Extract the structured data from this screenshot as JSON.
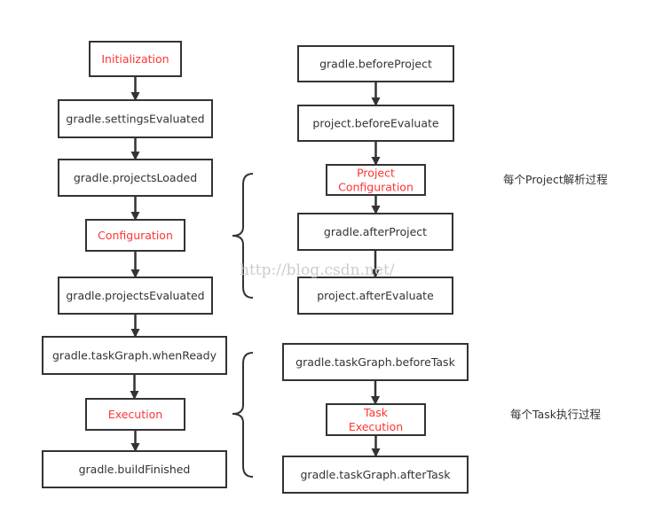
{
  "left_column": [
    {
      "id": "init",
      "lines": [
        "Initialization"
      ],
      "phase": true
    },
    {
      "id": "settings",
      "lines": [
        "gradle.settingsEvaluated"
      ]
    },
    {
      "id": "loaded",
      "lines": [
        "gradle.projectsLoaded"
      ]
    },
    {
      "id": "config",
      "lines": [
        "Configuration"
      ],
      "phase": true
    },
    {
      "id": "evaluated",
      "lines": [
        "gradle.projectsEvaluated"
      ]
    },
    {
      "id": "ready",
      "lines": [
        "gradle.taskGraph.whenReady"
      ]
    },
    {
      "id": "exec",
      "lines": [
        "Execution"
      ],
      "phase": true
    },
    {
      "id": "finished",
      "lines": [
        "gradle.buildFinished"
      ]
    }
  ],
  "right_top": [
    {
      "id": "beforeProject",
      "lines": [
        "gradle.beforeProject"
      ]
    },
    {
      "id": "beforeEvaluate",
      "lines": [
        "project.beforeEvaluate"
      ]
    },
    {
      "id": "projConfig",
      "lines": [
        "Project",
        "Configuration"
      ],
      "phase": true
    },
    {
      "id": "afterProject",
      "lines": [
        "gradle.afterProject"
      ]
    },
    {
      "id": "afterEvaluate",
      "lines": [
        "project.afterEvaluate"
      ]
    }
  ],
  "right_bottom": [
    {
      "id": "beforeTask",
      "lines": [
        "gradle.taskGraph.beforeTask"
      ]
    },
    {
      "id": "taskExec",
      "lines": [
        "Task",
        "Execution"
      ],
      "phase": true
    },
    {
      "id": "afterTask",
      "lines": [
        "gradle.taskGraph.afterTask"
      ]
    }
  ],
  "notes": {
    "project": "每个Project解析过程",
    "task": "每个Task执行过程"
  },
  "watermark": "http://blog.csdn.net/",
  "colors": {
    "phase_text": "#ff3333",
    "stroke": "#333333"
  }
}
